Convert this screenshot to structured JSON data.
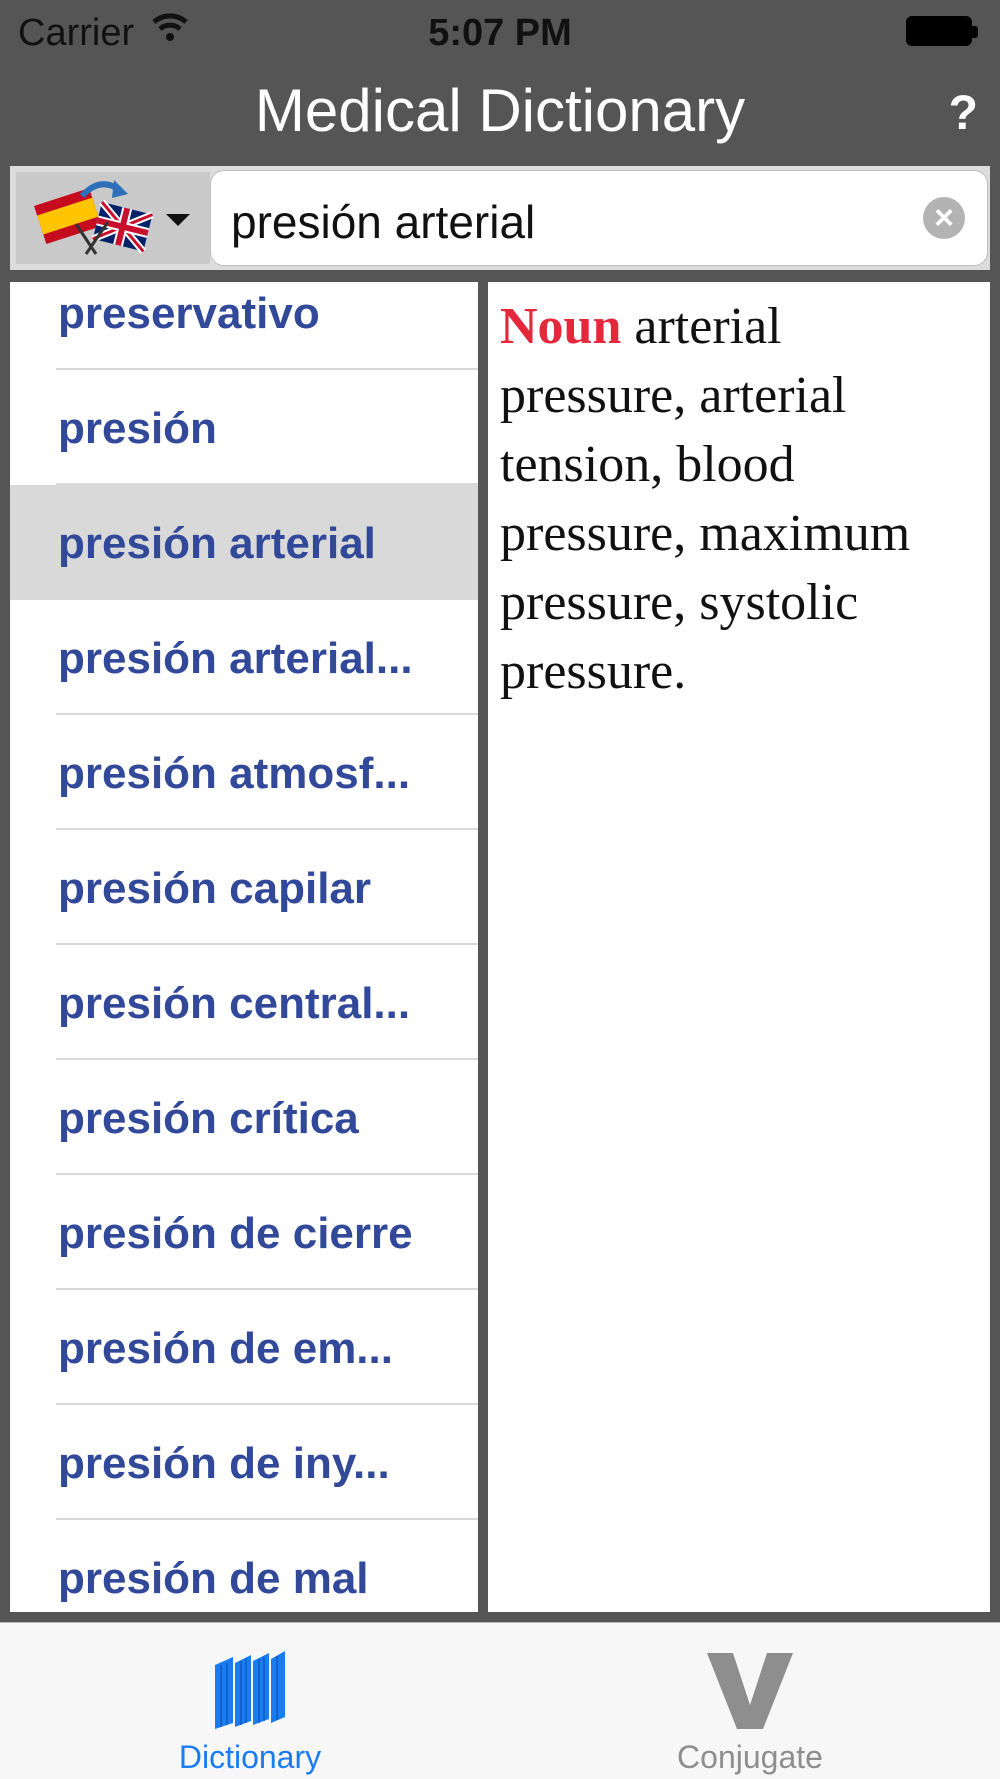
{
  "status_bar": {
    "carrier": "Carrier",
    "time": "5:07 PM"
  },
  "nav": {
    "title": "Medical Dictionary",
    "help_label": "?"
  },
  "search": {
    "value": "presión arterial",
    "language_direction": "spanish-to-english"
  },
  "word_list": {
    "items": [
      {
        "label": "preservativo"
      },
      {
        "label": "presión"
      },
      {
        "label": "presión arterial",
        "selected": true
      },
      {
        "label": "presión arterial..."
      },
      {
        "label": "presión atmosf..."
      },
      {
        "label": "presión capilar"
      },
      {
        "label": "presión central..."
      },
      {
        "label": "presión crítica"
      },
      {
        "label": "presión de cierre"
      },
      {
        "label": "presión de em..."
      },
      {
        "label": "presión de iny..."
      },
      {
        "label": "presión de mal"
      }
    ]
  },
  "definition": {
    "part_of_speech": "Noun",
    "text": " arterial pressure, arterial tension, blood pressure, maximum pressure, systolic pressure."
  },
  "tabs": [
    {
      "label": "Dictionary",
      "icon": "books-icon",
      "active": true
    },
    {
      "label": "Conjugate",
      "icon": "v-icon",
      "active": false
    }
  ],
  "colors": {
    "accent": "#1a7cf0",
    "list_text": "#32499a",
    "part_of_speech": "#e5273c",
    "chrome": "#555555"
  }
}
